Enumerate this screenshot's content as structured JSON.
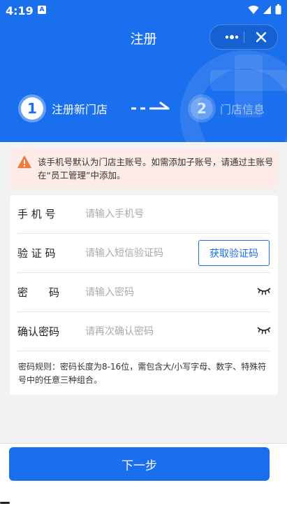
{
  "status_bar": {
    "time": "4:19",
    "app_badge": "A"
  },
  "nav": {
    "title": "注册"
  },
  "steps": [
    {
      "number": "1",
      "label": "注册新门店"
    },
    {
      "number": "2",
      "label": "门店信息"
    }
  ],
  "notice": {
    "text": "该手机号默认为门店主账号。如需添加子账号，请通过主账号在“员工管理”中添加。"
  },
  "form": {
    "phone": {
      "label": "手 机 号",
      "placeholder": "请输入手机号"
    },
    "code": {
      "label": "验 证 码",
      "placeholder": "请输入短信验证码",
      "button": "获取验证码"
    },
    "password": {
      "label": "密　　码",
      "placeholder": "请输入密码"
    },
    "confirm": {
      "label": "确认密码",
      "placeholder": "请再次确认密码"
    },
    "rules": "密码规则：密码长度为8-16位，需包含大/小写字母、数字、特殊符号中的任意三种组合。"
  },
  "footer": {
    "next_label": "下一步"
  },
  "colors": {
    "primary": "#1a6fee",
    "notice_bg": "#fcebe6",
    "warning": "#f07a3c"
  }
}
